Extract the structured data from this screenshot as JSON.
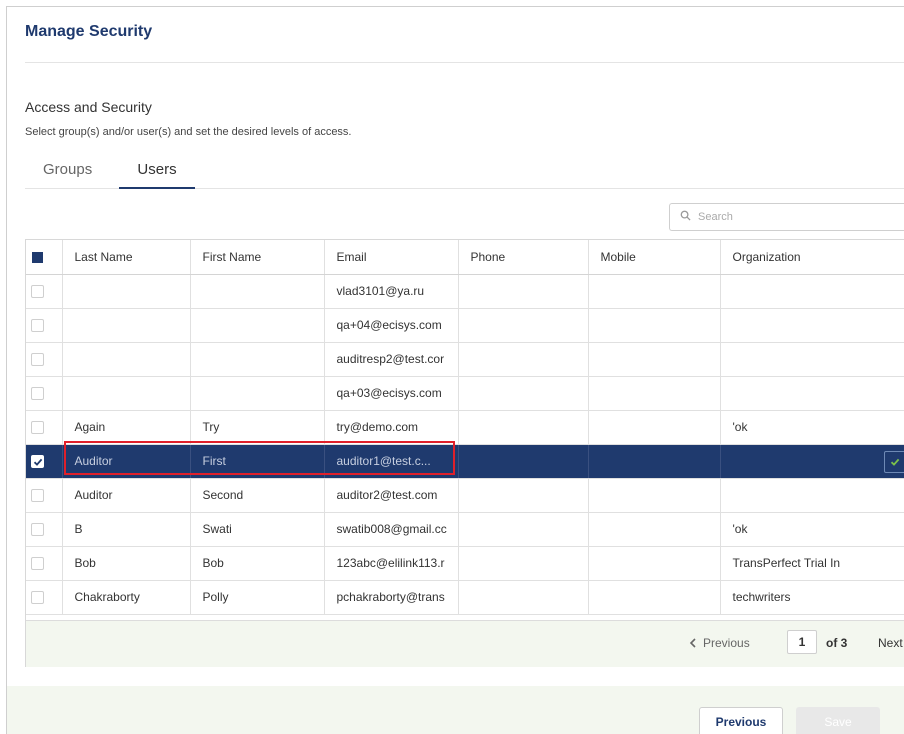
{
  "header": {
    "title": "Manage Security"
  },
  "section": {
    "title": "Access and Security",
    "description": "Select group(s) and/or user(s) and set the desired levels of access."
  },
  "tabs": [
    {
      "label": "Groups",
      "active": false
    },
    {
      "label": "Users",
      "active": true
    }
  ],
  "search": {
    "placeholder": "Search",
    "value": ""
  },
  "table": {
    "columns": [
      "Last Name",
      "First Name",
      "Email",
      "Phone",
      "Mobile",
      "Organization"
    ],
    "rows": [
      {
        "last": "",
        "first": "",
        "email": "vlad3101@ya.ru",
        "phone": "",
        "mobile": "",
        "org": ""
      },
      {
        "last": "",
        "first": "",
        "email": "qa+04@ecisys.com",
        "phone": "",
        "mobile": "",
        "org": ""
      },
      {
        "last": "",
        "first": "",
        "email": "auditresp2@test.cor",
        "phone": "",
        "mobile": "",
        "org": ""
      },
      {
        "last": "",
        "first": "",
        "email": "qa+03@ecisys.com",
        "phone": "",
        "mobile": "",
        "org": ""
      },
      {
        "last": "Again",
        "first": "Try",
        "email": "try@demo.com",
        "phone": "",
        "mobile": "",
        "org": "'ok"
      },
      {
        "last": "Auditor",
        "first": "First",
        "email": "auditor1@test.c...",
        "phone": "",
        "mobile": "",
        "org": ""
      },
      {
        "last": "Auditor",
        "first": "Second",
        "email": "auditor2@test.com",
        "phone": "",
        "mobile": "",
        "org": ""
      },
      {
        "last": "B",
        "first": "Swati",
        "email": "swatib008@gmail.cc",
        "phone": "",
        "mobile": "",
        "org": "'ok"
      },
      {
        "last": "Bob",
        "first": "Bob",
        "email": "123abc@elilink113.r",
        "phone": "",
        "mobile": "",
        "org": "TransPerfect Trial In"
      },
      {
        "last": "Chakraborty",
        "first": "Polly",
        "email": "pchakraborty@trans",
        "phone": "",
        "mobile": "",
        "org": "techwriters"
      }
    ]
  },
  "pager": {
    "previous": "Previous",
    "page": "1",
    "of": "of 3",
    "next": "Next"
  },
  "footer": {
    "previous": "Previous",
    "save": "Save"
  },
  "colors": {
    "primary": "#1f3a6e",
    "highlight": "#e0202a",
    "footer_bg": "#f3f7ef"
  }
}
